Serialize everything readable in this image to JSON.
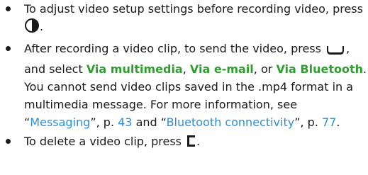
{
  "bullets": [
    {
      "before_icon": "To adjust video setup settings before recording video, press",
      "icon": "navigation-key-icon",
      "after_icon": "."
    },
    {
      "part1": "After recording a video clip, to send the video, press",
      "icon": "call-key-icon",
      "part2": ", and select",
      "option1": "Via multimedia",
      "sep1": ",",
      "option2": "Via e-mail",
      "sep2": ",",
      "part3": "or",
      "option3": "Via Bluetooth",
      "part4": ". You cannot send video clips saved in the .mp4 format in a multimedia message. For more information, see “",
      "link1": "Messaging",
      "part5": "”, p.",
      "page1": "43",
      "part6": "and “",
      "link2": "Bluetooth connectivity",
      "part7": "”, p.",
      "page2": "77",
      "part8": "."
    },
    {
      "before_icon": "To delete a video clip, press",
      "icon": "clear-key-icon",
      "after_icon": "."
    }
  ],
  "colors": {
    "text": "#1a1a1a",
    "option_green": "#2e9e2e",
    "link_blue": "#2a8fd8"
  }
}
